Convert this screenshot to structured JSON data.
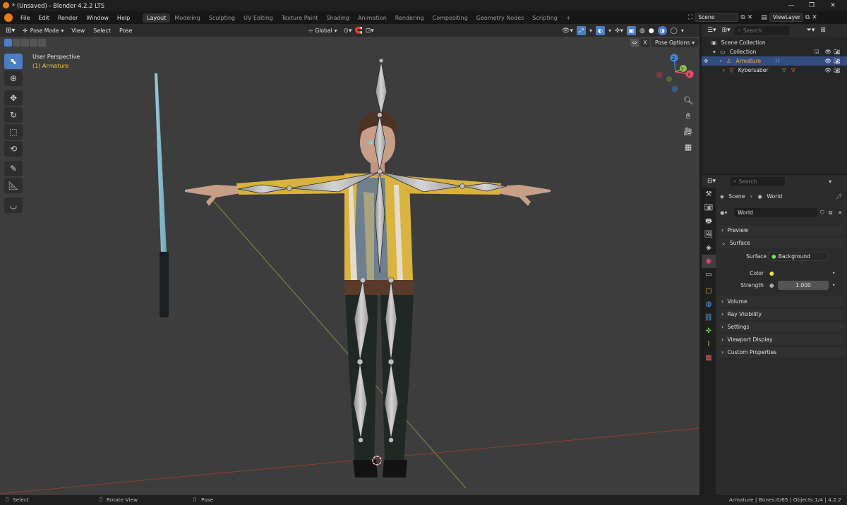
{
  "title_bar": {
    "title": "* (Unsaved) - Blender 4.2.2 LTS",
    "min_icon": "minimize-icon",
    "max_icon": "maximize-icon",
    "close_icon": "close-icon"
  },
  "menu": [
    "File",
    "Edit",
    "Render",
    "Window",
    "Help"
  ],
  "workspaces": [
    "Layout",
    "Modeling",
    "Sculpting",
    "UV Editing",
    "Texture Paint",
    "Shading",
    "Animation",
    "Rendering",
    "Compositing",
    "Geometry Nodes",
    "Scripting"
  ],
  "active_workspace": "Layout",
  "add_workspace": "+",
  "scene": {
    "name": "Scene",
    "view_layer": "ViewLayer"
  },
  "viewport_header": {
    "mode": "Pose Mode",
    "menus": [
      "View",
      "Select",
      "Pose"
    ],
    "orientation": "Global",
    "pose_options": "Pose Options"
  },
  "viewport": {
    "perspective": "User Perspective",
    "active_object": "(1) Armature"
  },
  "outliner": {
    "search_placeholder": "Search",
    "scene_collection": "Scene Collection",
    "collection": "Collection",
    "items": [
      {
        "name": "Armature",
        "selected": true
      },
      {
        "name": "Kybersaber",
        "selected": false
      }
    ]
  },
  "properties": {
    "search_placeholder": "Search",
    "breadcrumb": [
      "Scene",
      "World"
    ],
    "world_name": "World",
    "panels_collapsed": [
      "Preview",
      "Volume",
      "Ray Visibility",
      "Settings",
      "Viewport Display",
      "Custom Properties"
    ],
    "surface_panel": "Surface",
    "surface_label": "Surface",
    "surface_value": "Background",
    "color_label": "Color",
    "strength_label": "Strength",
    "strength_value": "1.000"
  },
  "status_bar": {
    "left": [
      "Select",
      "Rotate View",
      "Pose"
    ],
    "right": "Armature | Bones:0/65 | Objects:1/4 | 4.2.2"
  },
  "colors": {
    "accent_blue": "#4d7ec5",
    "selected_row": "#334d80",
    "armature_text": "#f0a84a",
    "active_object_yellow": "#e6c84b",
    "gizmo_x": "#e64f5f",
    "gizmo_y": "#8bc34a",
    "gizmo_z": "#3f86d8"
  }
}
